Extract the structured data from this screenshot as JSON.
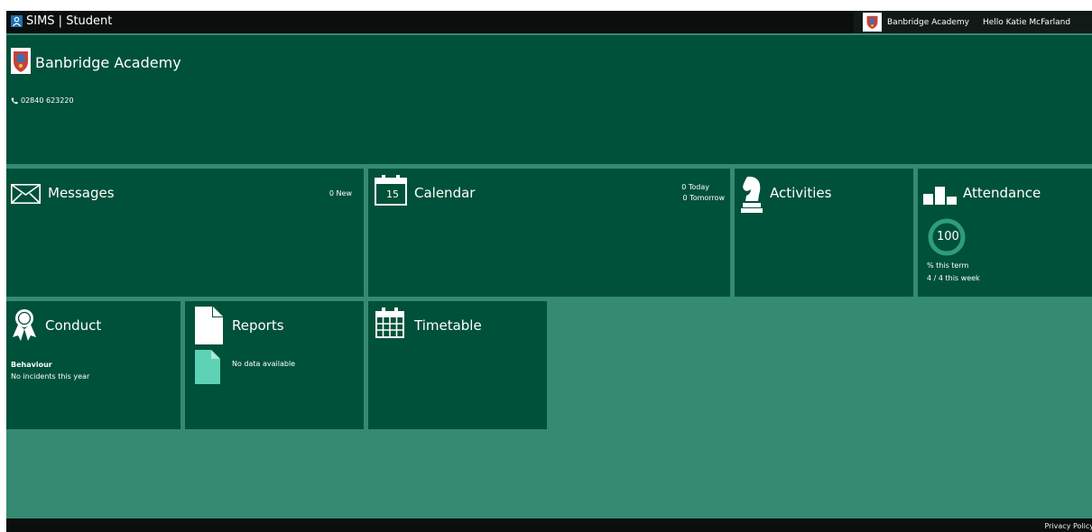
{
  "app": {
    "title": "SIMS | Student"
  },
  "topbar": {
    "school": "Banbridge Academy",
    "greeting": "Hello Katie McFarland"
  },
  "school": {
    "name": "Banbridge Academy",
    "phone": "02840 623220"
  },
  "tiles": {
    "messages": {
      "title": "Messages",
      "count": "0 New"
    },
    "calendar": {
      "title": "Calendar",
      "day": "15",
      "today": "0 Today",
      "tomorrow": "0 Tomorrow"
    },
    "activities": {
      "title": "Activities"
    },
    "attendance": {
      "title": "Attendance",
      "percent": "100",
      "term_label": "% this term",
      "week": "4 / 4 this week"
    },
    "conduct": {
      "title": "Conduct",
      "subtitle": "Behaviour",
      "detail": "No incidents this year"
    },
    "reports": {
      "title": "Reports",
      "empty": "No data available"
    },
    "timetable": {
      "title": "Timetable"
    }
  },
  "footer": {
    "privacy": "Privacy Policy"
  },
  "colors": {
    "tile": "#005139",
    "background": "#358a72",
    "bar": "#0a0f0e",
    "accent": "#5fd1b4"
  }
}
